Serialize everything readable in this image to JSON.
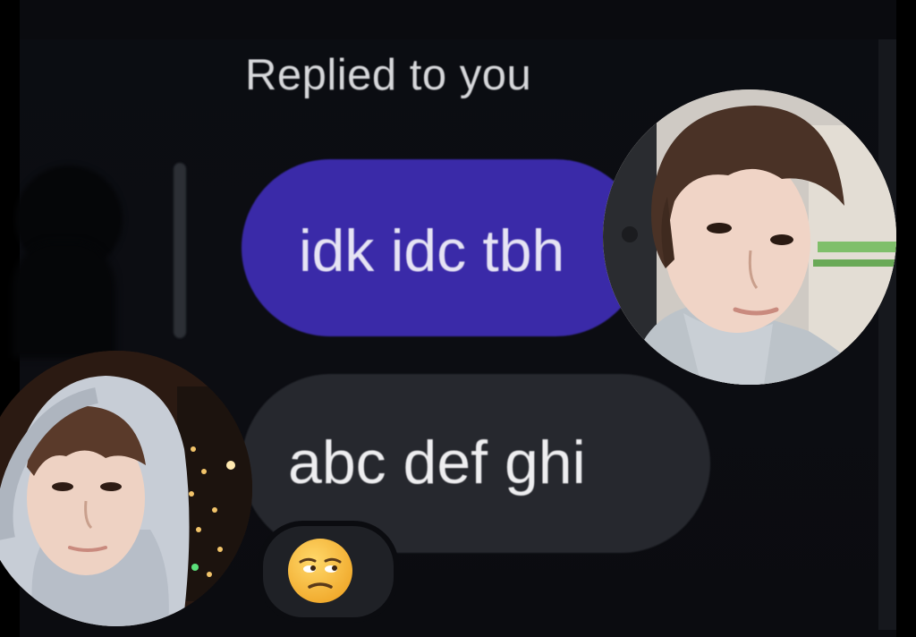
{
  "conversation": {
    "reply_header": "Replied to you",
    "quoted_message": "idk idc tbh",
    "reply_message": "abc def ghi",
    "reaction_icon": "unamused-face-icon"
  },
  "overlays": {
    "right_photo": "profile-photo",
    "left_photo": "profile-photo"
  },
  "colors": {
    "quoted_bubble": "#3a2aa8",
    "reply_bubble": "#26282e",
    "background": "#0b0d12"
  }
}
